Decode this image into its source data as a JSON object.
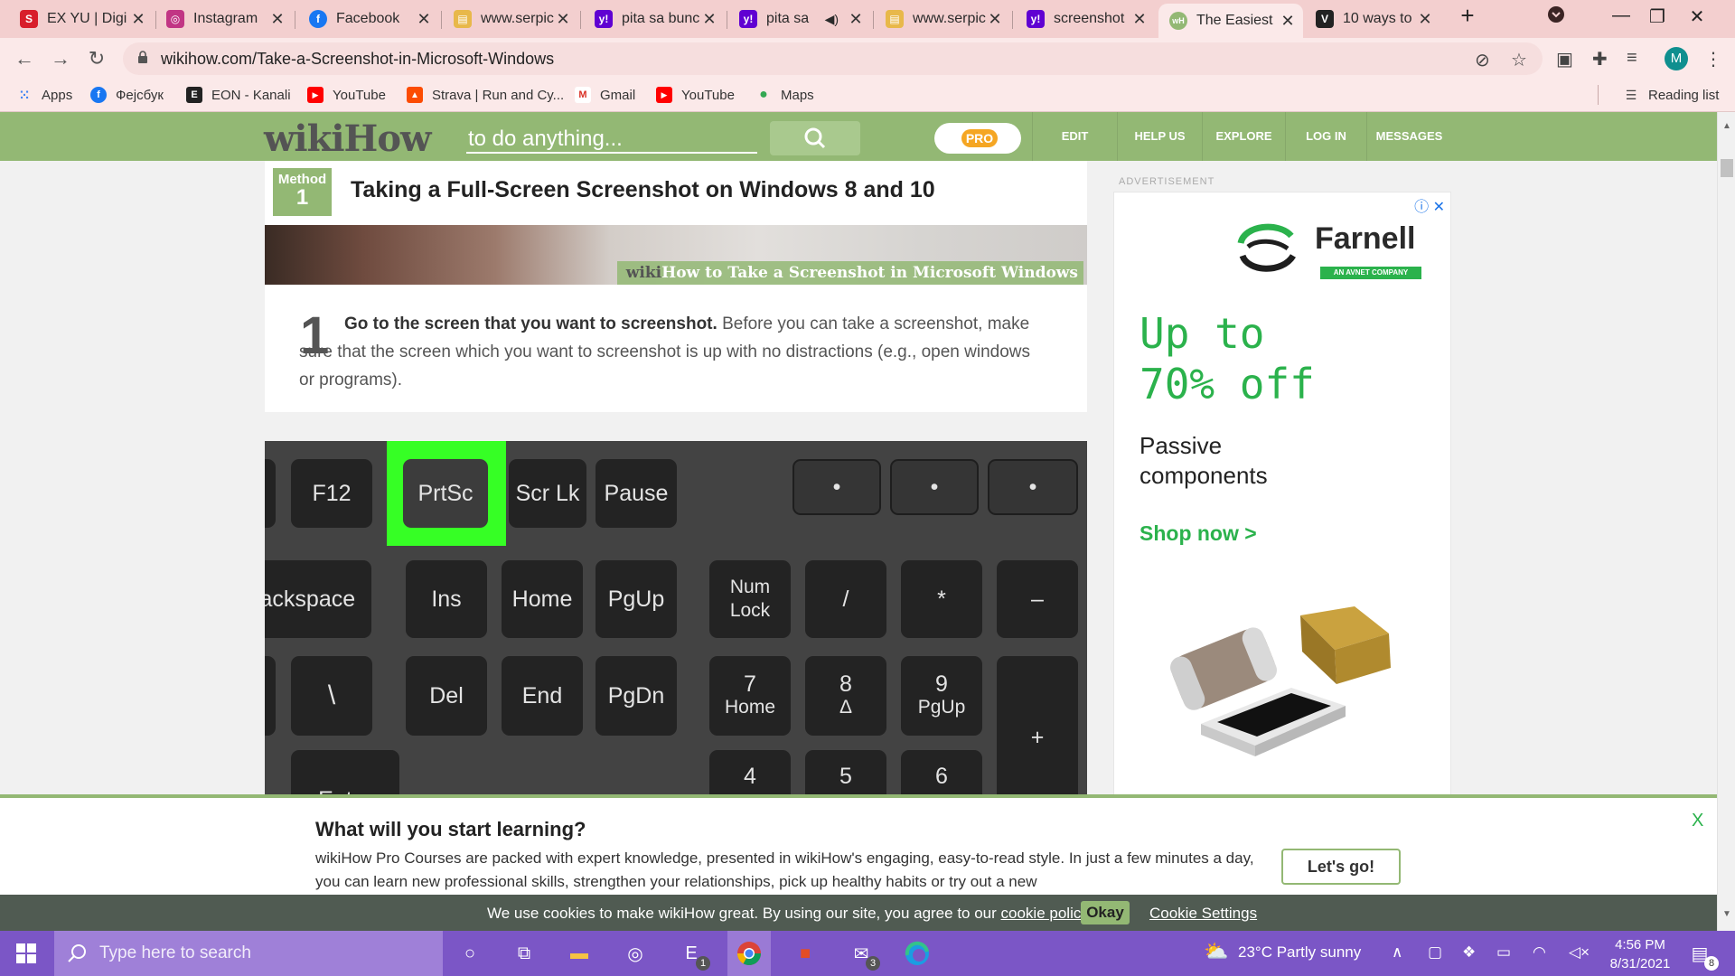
{
  "browser": {
    "tabs": [
      {
        "title": "EX YU | Digi",
        "color": "#d81e2b",
        "glyph": "S"
      },
      {
        "title": "Instagram",
        "color": "#c13584",
        "glyph": "◎"
      },
      {
        "title": "Facebook",
        "color": "#1877f2",
        "glyph": "f"
      },
      {
        "title": "www.serpic",
        "color": "#e8b84a",
        "glyph": "▤"
      },
      {
        "title": "pita sa bunc",
        "color": "#6001d2",
        "glyph": "y!"
      },
      {
        "title": "pita sa",
        "color": "#6001d2",
        "glyph": "y!"
      },
      {
        "title": "www.serpic",
        "color": "#e8b84a",
        "glyph": "▤"
      },
      {
        "title": "screenshot",
        "color": "#6001d2",
        "glyph": "y!"
      },
      {
        "title": "The Easiest",
        "color": "#93b874",
        "glyph": "wH"
      },
      {
        "title": "10 ways to",
        "color": "#222222",
        "glyph": "V"
      }
    ],
    "new_tab": "+",
    "url": "wikihow.com/Take-a-Screenshot-in-Microsoft-Windows",
    "avatar_letter": "M",
    "bookmarks": [
      {
        "label": "Apps",
        "color": "#e94235",
        "glyph": "⋮⋮"
      },
      {
        "label": "Фејсбук",
        "color": "#1877f2",
        "glyph": "f"
      },
      {
        "label": "EON - Kanali",
        "color": "#222222",
        "glyph": "E"
      },
      {
        "label": "YouTube",
        "color": "#ff0000",
        "glyph": "▶"
      },
      {
        "label": "Strava | Run and Cy...",
        "color": "#fc4c02",
        "glyph": "▲"
      },
      {
        "label": "Gmail",
        "color": "#d93025",
        "glyph": "M"
      },
      {
        "label": "YouTube",
        "color": "#ff0000",
        "glyph": "▶"
      },
      {
        "label": "Maps",
        "color": "#34a853",
        "glyph": "●"
      }
    ],
    "reading_list": "Reading list"
  },
  "wikihow": {
    "logo_wiki": "wiki",
    "logo_how": "How",
    "search_placeholder": "to do anything...",
    "pro_label": "PRO",
    "nav": [
      "EDIT",
      "HELP US",
      "EXPLORE",
      "LOG IN",
      "MESSAGES"
    ],
    "method_label": "Method",
    "method_number": "1",
    "method_title": "Taking a Full-Screen Screenshot on Windows 8 and 10",
    "hero_caption_wiki": "wiki",
    "hero_caption_rest": "How to Take a Screenshot in Microsoft Windows",
    "step_number": "1",
    "step_bold": "Go to the screen that you want to screenshot.",
    "step_rest": " Before you can take a screenshot, make sure that the screen which you want to screenshot is up with no distractions (e.g., open windows or programs).",
    "keyboard": {
      "row1": [
        "F12",
        "PrtSc",
        "Scr Lk",
        "Pause"
      ],
      "row2": [
        "Backspace",
        "Ins",
        "Home",
        "PgUp",
        "Num Lock",
        "/",
        "*",
        "–"
      ],
      "row3": [
        "\\",
        "Del",
        "End",
        "PgDn"
      ],
      "numpad3": [
        {
          "top": "7",
          "bottom": "Home"
        },
        {
          "top": "8",
          "bottom": "Δ"
        },
        {
          "top": "9",
          "bottom": "PgUp"
        }
      ],
      "plus": "+",
      "row4": [
        "Enter",
        "4",
        "5",
        "6"
      ],
      "dot": "•",
      "pipe": "|"
    }
  },
  "ad": {
    "label": "ADVERTISEMENT",
    "brand": "Farnell",
    "brand_tag": "AN AVNET COMPANY",
    "headline_1": "Up to",
    "headline_2": "70% off",
    "sub_1": "Passive",
    "sub_2": "components",
    "cta": "Shop now >"
  },
  "pro_banner": {
    "question": "What will you start learning?",
    "description": "wikiHow Pro Courses are packed with expert knowledge, presented in wikiHow's engaging, easy-to-read style. In just a few minutes a day, you can learn new professional skills, strengthen your relationships, pick up healthy habits or try out a new",
    "button": "Let's go!",
    "close": "X"
  },
  "cookie": {
    "message": "We use cookies to make wikiHow great. By using our site, you agree to our ",
    "policy_link": "cookie policy",
    "period": ".",
    "ok": "Okay",
    "settings": "Cookie Settings"
  },
  "taskbar": {
    "search_placeholder": "Type here to search",
    "weather": "23°C  Partly sunny",
    "time": "4:56 PM",
    "date": "8/31/2021",
    "badge_app": "1",
    "badge_mail": "3",
    "badge_notif": "8"
  }
}
